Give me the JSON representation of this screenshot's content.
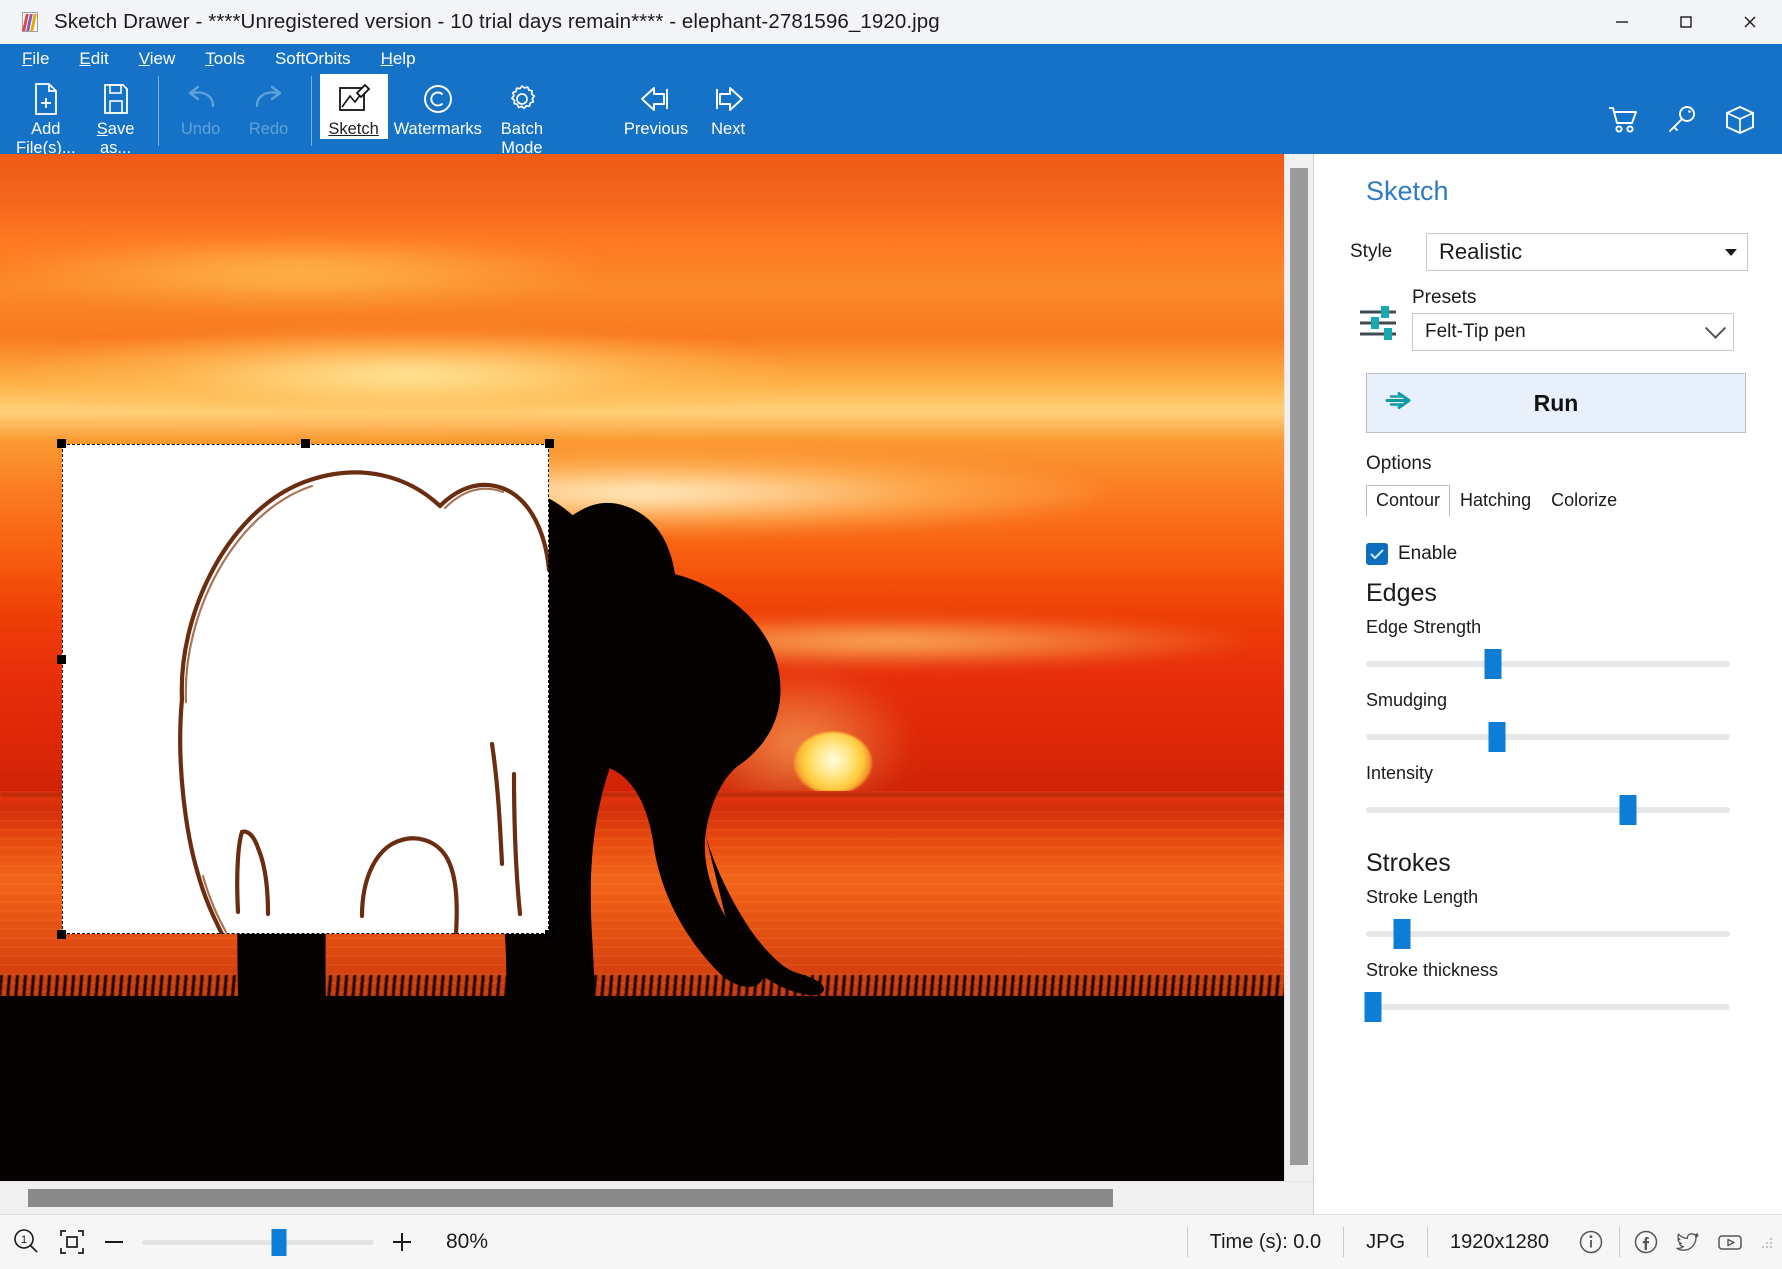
{
  "window": {
    "title": "Sketch Drawer - ****Unregistered version - 10 trial days remain**** - elephant-2781596_1920.jpg",
    "app_icon": "sketch-drawer-icon",
    "minimize_label": "Minimize",
    "maximize_label": "Maximize",
    "close_label": "Close",
    "accent_blue": "#1572c6"
  },
  "menubar": {
    "items": [
      {
        "label": "File",
        "mnemonic": "F"
      },
      {
        "label": "Edit",
        "mnemonic": "E"
      },
      {
        "label": "View",
        "mnemonic": "V"
      },
      {
        "label": "Tools",
        "mnemonic": "T"
      },
      {
        "label": "SoftOrbits",
        "mnemonic": ""
      },
      {
        "label": "Help",
        "mnemonic": "H"
      }
    ]
  },
  "toolbar": {
    "add_files": "Add\nFile(s)...",
    "save_as": "Save\nas...",
    "undo": "Undo",
    "redo": "Redo",
    "sketch": "Sketch",
    "watermarks": "Watermarks",
    "batch_mode": "Batch\nMode",
    "previous": "Previous",
    "next": "Next",
    "right_icons": [
      "cart-icon",
      "key-icon",
      "box-icon"
    ]
  },
  "panel": {
    "title": "Sketch",
    "style_label": "Style",
    "style_value": "Realistic",
    "presets_label": "Presets",
    "presets_value": "Felt-Tip pen",
    "run_label": "Run",
    "options_label": "Options",
    "tabs": [
      {
        "label": "Contour",
        "active": true
      },
      {
        "label": "Hatching",
        "active": false
      },
      {
        "label": "Colorize",
        "active": false
      }
    ],
    "enable_label": "Enable",
    "enable_checked": true,
    "sections": [
      {
        "heading": "Edges",
        "sliders": [
          {
            "label": "Edge Strength",
            "percent": 35
          },
          {
            "label": "Smudging",
            "percent": 36
          },
          {
            "label": "Intensity",
            "percent": 72
          }
        ]
      },
      {
        "heading": "Strokes",
        "sliders": [
          {
            "label": "Stroke Length",
            "percent": 10
          },
          {
            "label": "Stroke thickness",
            "percent": 2
          }
        ]
      }
    ],
    "accent_blue": "#0d7dd6",
    "title_color": "#2e7bc4",
    "run_bg": "#e8f1fb"
  },
  "statusbar": {
    "zoom_actual_icon": "zoom-actual-size-icon",
    "fit_icon": "fit-to-window-icon",
    "zoom_out": "−",
    "zoom_in": "+",
    "zoom_percent": "80%",
    "zoom_slider_percent": 59,
    "time": "Time (s): 0.0",
    "format": "JPG",
    "dimensions": "1920x1280",
    "icons": [
      "info-icon",
      "facebook-icon",
      "twitter-icon",
      "youtube-icon"
    ]
  },
  "canvas": {
    "image_description": "elephant silhouette at sunset over the sea",
    "selection_label": "sketch-preview-selection"
  }
}
